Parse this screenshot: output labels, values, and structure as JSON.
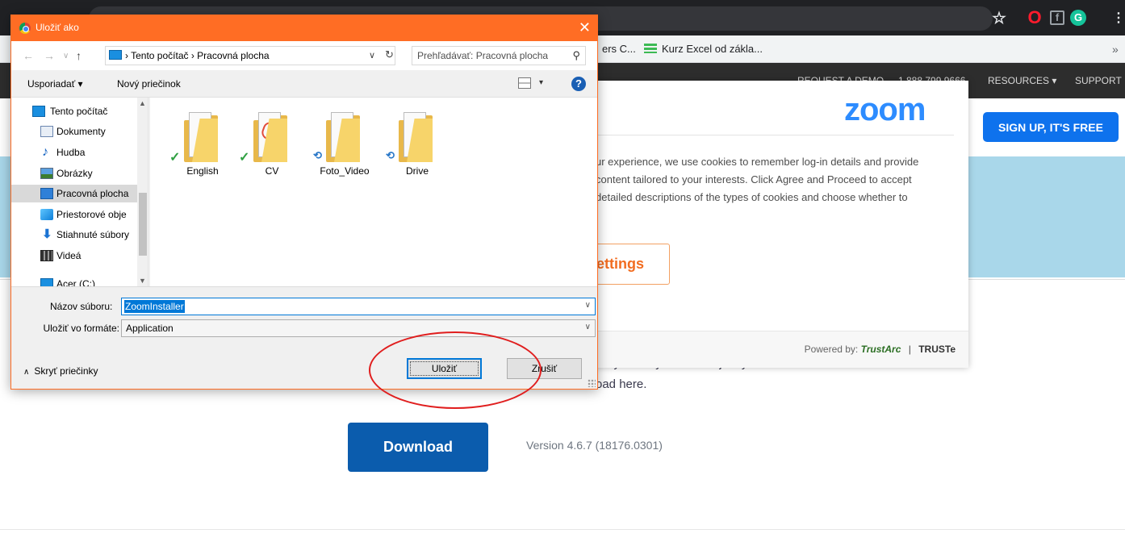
{
  "browser": {
    "bookmarks": [
      {
        "label": "ers C..."
      },
      {
        "label": "Kurz Excel od zákla..."
      }
    ],
    "bookmarks_more": "»"
  },
  "zoom_site": {
    "nav": {
      "request_demo": "REQUEST A DEMO",
      "phone": "1.888.799.9666",
      "resources": "RESOURCES ▾",
      "support": "SUPPORT"
    },
    "signup_button": "SIGN UP, IT'S FREE",
    "description_line1": "cally when you start or join your first Zoom",
    "description_line2": "oad here.",
    "download_button": "Download",
    "version": "Version 4.6.7 (18176.0301)"
  },
  "cookie_banner": {
    "logo": "zoom",
    "text_lines": [
      "ur experience, we use cookies to remember log-in details and provide",
      "content tailored to your interests. Click Agree and Proceed to accept",
      " detailed descriptions of the types of cookies and choose whether to"
    ],
    "settings_button": "ettings",
    "powered_by": "Powered by:",
    "trustarc": "TrustArc",
    "separator": "|",
    "truste": "TRUSTe"
  },
  "save_dialog": {
    "title": "Uložiť ako",
    "close": "✕",
    "nav": {
      "back": "←",
      "forward": "→",
      "recent": "∨",
      "up": "↑"
    },
    "address": {
      "path": "› Tento počítač › Pracovná plocha",
      "dropdown": "∨",
      "refresh": "↻"
    },
    "search_placeholder": "Prehľadávať: Pracovná plocha",
    "toolbar": {
      "organize": "Usporiadať ▾",
      "new_folder": "Nový priečinok",
      "view_chevron": "▾",
      "help": "?"
    },
    "navigation_pane": [
      {
        "label": "Tento počítač",
        "icon": "computer-icon",
        "selected": false
      },
      {
        "label": "Dokumenty",
        "icon": "documents-icon",
        "selected": false
      },
      {
        "label": "Hudba",
        "icon": "music-icon",
        "selected": false
      },
      {
        "label": "Obrázky",
        "icon": "pictures-icon",
        "selected": false
      },
      {
        "label": "Pracovná plocha",
        "icon": "desktop-icon",
        "selected": true
      },
      {
        "label": "Priestorové obje",
        "icon": "3d-objects-icon",
        "selected": false
      },
      {
        "label": "Stiahnuté súbory",
        "icon": "downloads-icon",
        "selected": false
      },
      {
        "label": "Videá",
        "icon": "videos-icon",
        "selected": false
      },
      {
        "label": "Acer (C:)",
        "icon": "drive-icon",
        "selected": false
      }
    ],
    "scroll_up": "▲",
    "scroll_down": "▼",
    "files": [
      {
        "name": "English",
        "sync": "synced"
      },
      {
        "name": "CV",
        "sync": "synced"
      },
      {
        "name": "Foto_Video",
        "sync": "pending"
      },
      {
        "name": "Drive",
        "sync": "pending"
      }
    ],
    "sync_ok_glyph": "✓",
    "sync_pending_glyph": "⟲",
    "filename_label": "Názov súboru:",
    "filename_value": "ZoomInstaller",
    "format_label": "Uložiť vo formáte:",
    "format_value": "Application",
    "field_chevron": "∨",
    "hide_folders": "Skryť priečinky",
    "hide_folders_chevron": "∧",
    "save_button": "Uložiť",
    "cancel_button": "Zrušiť"
  },
  "colors": {
    "dialog_titlebar": "#ff6d24",
    "annotation": "#e01e1e",
    "zoom_blue": "#2d8cff",
    "download_button": "#0b5cad"
  }
}
